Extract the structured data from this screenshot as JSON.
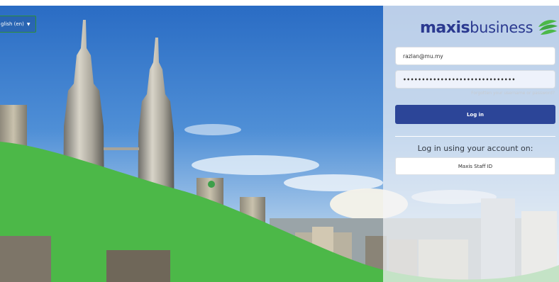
{
  "language": {
    "label": "glish (en)",
    "icon": "caret-down-icon"
  },
  "brand": {
    "bold": "maxis",
    "light": "business",
    "icon": "maxis-leaf-logo-icon",
    "color": "#2b3990",
    "green": "#4cb848"
  },
  "login": {
    "username_value": "razlan@mu.my",
    "password_value": "••••••••••••••••••••••••••••••",
    "forgot_link": "Forgotten your username or password?",
    "login_button": "Log in",
    "alt_heading": "Log in using your account on:",
    "sso_button": "Maxis Staff ID"
  },
  "colors": {
    "primary_button": "#2c4598",
    "wave_green": "#4cb848"
  }
}
